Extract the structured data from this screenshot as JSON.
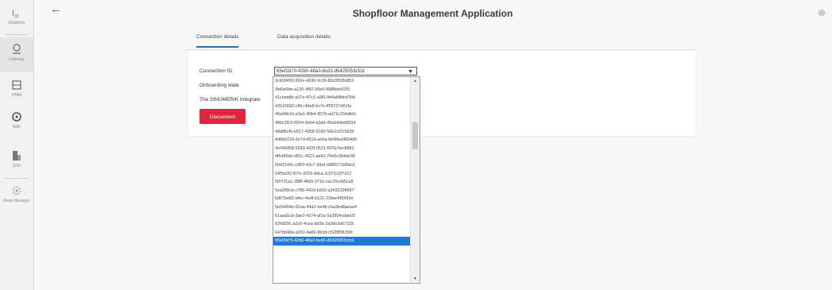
{
  "app": {
    "title": "Shopfloor Management Application"
  },
  "sidebar": {
    "items": [
      {
        "label": "Shopfloor",
        "icon": "shopfloor-icon"
      },
      {
        "label": "Gateway",
        "icon": "gateway-icon"
      },
      {
        "label": "HMM",
        "icon": "hmm-icon"
      },
      {
        "label": "AMP",
        "icon": "amp-icon"
      },
      {
        "label": "SSA",
        "icon": "ssa-icon"
      },
      {
        "label": "Asset Manager",
        "icon": "asset-manager-icon"
      }
    ]
  },
  "tabs": [
    {
      "label": "Connection details",
      "active": true
    },
    {
      "label": "Data acquisition details",
      "active": false
    }
  ],
  "form": {
    "connection_id_label": "Connection ID",
    "onboarding_state_label": "Onboarding state",
    "integrate_label": "The SINUMERIK Integrate",
    "connection_id_value": "65ef2d70-42b0-48a3-bcd3-d5425053cfcd",
    "disconnect_label": "Disconnect"
  },
  "dropdown": {
    "options": [
      "3cb09450-992e-42d9-9c36-80cf952bbf53",
      "3fd0e0bb-a135-4f92-95e5-f68f8efe62f3",
      "41cbea8b-a07e-47c1-a9f9-4d4a89bb47bb",
      "42b15692-cf0c-44e8-bc7e-ff55727d51fa",
      "46a06b16-e3a1-40b4-8076-ad71c294db0c",
      "486c2f19-9024-4b54-a3dd-45eb4dbb862d",
      "48dd5cfe-b517-4358-9160-5de2cf215d3b",
      "4d8b0216-9e7d-4516-ae5a-b649ea9604d0",
      "4e946858-5583-423f-9531-f970c5ec8881",
      "4f6d85de-d51c-4621-ae62-70e5c0b4de96",
      "5042199c-c453-43c7-99af-dd86273d0dc9",
      "54f5b2f2-f07e-4255-9dca-1c07122f7d17",
      "587cf1a1-28f8-46b5-971b-cac25ce85ca5",
      "5ea288cb-c786-442d-b310-a243215f6f97",
      "5d67be82-bfec-4edf-b121-23fae445993e",
      "5e09404e-82aa-44a2-be48-cba3bd8aeae4",
      "61aad1cd-3ae3-4274-af1a-5a3954cdae03",
      "62fa82fc-a2c6-4cea-bd3b-2a3de3a67155",
      "647bb98a-a051-4a66-8d3d-c528f5ffc506",
      "65ef2d70-42b0-48a3-bcd3-d5425053cfcd"
    ],
    "selected_index": 19
  }
}
